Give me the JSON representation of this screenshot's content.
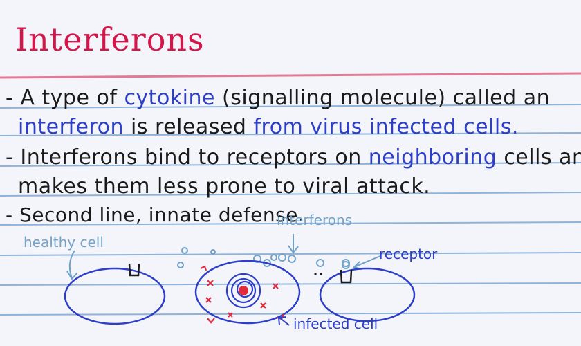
{
  "title": "Interferons",
  "notes": {
    "line1": {
      "prefix": "- A type of ",
      "term1": "cytokine",
      "rest": " (signalling molecule) called an"
    },
    "line2": {
      "term2": "interferon",
      "mid": " is released ",
      "term3": "from virus infected cells."
    },
    "line3": {
      "prefix": "- Interferons bind to receptors on ",
      "term4": "neighboring",
      "rest": " cells and"
    },
    "line4": "makes them less prone to viral attack.",
    "line5": "- Second line, innate defense."
  },
  "diagram": {
    "label_healthy": "healthy cell",
    "label_interferons": "interferons",
    "label_receptor": "receptor",
    "label_infected": "infected cell"
  },
  "colors": {
    "title": "#d3174a",
    "ink": "#1a1a1a",
    "blue_ink": "#2d3ec9",
    "faint_ink": "#74a3c8",
    "rule_lines": "#8fb2d8",
    "margin_line": "#e37a95",
    "marks": "#e02a3d"
  }
}
